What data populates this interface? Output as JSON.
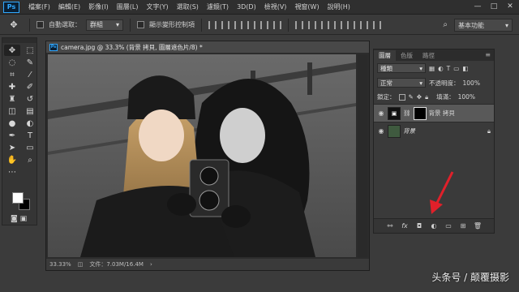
{
  "app": {
    "logo": "Ps"
  },
  "menu": [
    "檔案(F)",
    "編輯(E)",
    "影像(I)",
    "圖層(L)",
    "文字(Y)",
    "選取(S)",
    "濾鏡(T)",
    "3D(D)",
    "檢視(V)",
    "視窗(W)",
    "說明(H)"
  ],
  "window_controls": [
    "—",
    "□",
    "✕"
  ],
  "options": {
    "auto_select_label": "自動選取：",
    "auto_select_value": "群組",
    "show_transform_label": "顯示變形控制項",
    "workspace": "基本功能"
  },
  "document": {
    "tab_title": "camera.jpg @ 33.3% (背景 拷貝, 圖層遮色片/8) *",
    "zoom": "33.33%",
    "file_info": "文件：7.03M/16.4M"
  },
  "layers_panel": {
    "tabs": [
      "圖層",
      "色版",
      "路徑"
    ],
    "filter": "種類",
    "blend_mode": "正常",
    "opacity_label": "不透明度：",
    "opacity": "100%",
    "lock_label": "鎖定：",
    "fill_label": "填滿：",
    "fill": "100%",
    "layers": [
      {
        "name": "背景 拷貝",
        "selected": true,
        "has_mask": true
      },
      {
        "name": "背景",
        "selected": false,
        "has_mask": false
      }
    ],
    "footer_buttons": [
      "link-icon",
      "fx-icon",
      "add-mask-icon",
      "adjustment-icon",
      "group-icon",
      "new-layer-icon",
      "trash-icon"
    ]
  },
  "watermark": "头条号 / 颠覆摄影",
  "colors": {
    "accent": "#31a8ff",
    "arrow": "#e0202a"
  }
}
